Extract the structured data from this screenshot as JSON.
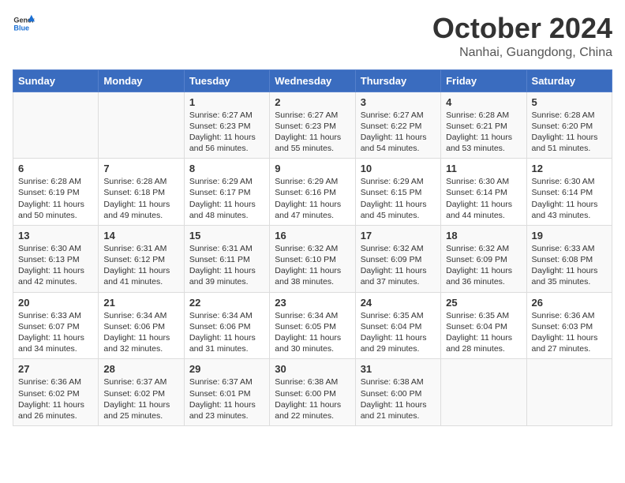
{
  "header": {
    "logo_general": "General",
    "logo_blue": "Blue",
    "title": "October 2024",
    "location": "Nanhai, Guangdong, China"
  },
  "calendar": {
    "weekdays": [
      "Sunday",
      "Monday",
      "Tuesday",
      "Wednesday",
      "Thursday",
      "Friday",
      "Saturday"
    ],
    "weeks": [
      [
        {
          "day": "",
          "text": ""
        },
        {
          "day": "",
          "text": ""
        },
        {
          "day": "1",
          "text": "Sunrise: 6:27 AM\nSunset: 6:23 PM\nDaylight: 11 hours and 56 minutes."
        },
        {
          "day": "2",
          "text": "Sunrise: 6:27 AM\nSunset: 6:23 PM\nDaylight: 11 hours and 55 minutes."
        },
        {
          "day": "3",
          "text": "Sunrise: 6:27 AM\nSunset: 6:22 PM\nDaylight: 11 hours and 54 minutes."
        },
        {
          "day": "4",
          "text": "Sunrise: 6:28 AM\nSunset: 6:21 PM\nDaylight: 11 hours and 53 minutes."
        },
        {
          "day": "5",
          "text": "Sunrise: 6:28 AM\nSunset: 6:20 PM\nDaylight: 11 hours and 51 minutes."
        }
      ],
      [
        {
          "day": "6",
          "text": "Sunrise: 6:28 AM\nSunset: 6:19 PM\nDaylight: 11 hours and 50 minutes."
        },
        {
          "day": "7",
          "text": "Sunrise: 6:28 AM\nSunset: 6:18 PM\nDaylight: 11 hours and 49 minutes."
        },
        {
          "day": "8",
          "text": "Sunrise: 6:29 AM\nSunset: 6:17 PM\nDaylight: 11 hours and 48 minutes."
        },
        {
          "day": "9",
          "text": "Sunrise: 6:29 AM\nSunset: 6:16 PM\nDaylight: 11 hours and 47 minutes."
        },
        {
          "day": "10",
          "text": "Sunrise: 6:29 AM\nSunset: 6:15 PM\nDaylight: 11 hours and 45 minutes."
        },
        {
          "day": "11",
          "text": "Sunrise: 6:30 AM\nSunset: 6:14 PM\nDaylight: 11 hours and 44 minutes."
        },
        {
          "day": "12",
          "text": "Sunrise: 6:30 AM\nSunset: 6:14 PM\nDaylight: 11 hours and 43 minutes."
        }
      ],
      [
        {
          "day": "13",
          "text": "Sunrise: 6:30 AM\nSunset: 6:13 PM\nDaylight: 11 hours and 42 minutes."
        },
        {
          "day": "14",
          "text": "Sunrise: 6:31 AM\nSunset: 6:12 PM\nDaylight: 11 hours and 41 minutes."
        },
        {
          "day": "15",
          "text": "Sunrise: 6:31 AM\nSunset: 6:11 PM\nDaylight: 11 hours and 39 minutes."
        },
        {
          "day": "16",
          "text": "Sunrise: 6:32 AM\nSunset: 6:10 PM\nDaylight: 11 hours and 38 minutes."
        },
        {
          "day": "17",
          "text": "Sunrise: 6:32 AM\nSunset: 6:09 PM\nDaylight: 11 hours and 37 minutes."
        },
        {
          "day": "18",
          "text": "Sunrise: 6:32 AM\nSunset: 6:09 PM\nDaylight: 11 hours and 36 minutes."
        },
        {
          "day": "19",
          "text": "Sunrise: 6:33 AM\nSunset: 6:08 PM\nDaylight: 11 hours and 35 minutes."
        }
      ],
      [
        {
          "day": "20",
          "text": "Sunrise: 6:33 AM\nSunset: 6:07 PM\nDaylight: 11 hours and 34 minutes."
        },
        {
          "day": "21",
          "text": "Sunrise: 6:34 AM\nSunset: 6:06 PM\nDaylight: 11 hours and 32 minutes."
        },
        {
          "day": "22",
          "text": "Sunrise: 6:34 AM\nSunset: 6:06 PM\nDaylight: 11 hours and 31 minutes."
        },
        {
          "day": "23",
          "text": "Sunrise: 6:34 AM\nSunset: 6:05 PM\nDaylight: 11 hours and 30 minutes."
        },
        {
          "day": "24",
          "text": "Sunrise: 6:35 AM\nSunset: 6:04 PM\nDaylight: 11 hours and 29 minutes."
        },
        {
          "day": "25",
          "text": "Sunrise: 6:35 AM\nSunset: 6:04 PM\nDaylight: 11 hours and 28 minutes."
        },
        {
          "day": "26",
          "text": "Sunrise: 6:36 AM\nSunset: 6:03 PM\nDaylight: 11 hours and 27 minutes."
        }
      ],
      [
        {
          "day": "27",
          "text": "Sunrise: 6:36 AM\nSunset: 6:02 PM\nDaylight: 11 hours and 26 minutes."
        },
        {
          "day": "28",
          "text": "Sunrise: 6:37 AM\nSunset: 6:02 PM\nDaylight: 11 hours and 25 minutes."
        },
        {
          "day": "29",
          "text": "Sunrise: 6:37 AM\nSunset: 6:01 PM\nDaylight: 11 hours and 23 minutes."
        },
        {
          "day": "30",
          "text": "Sunrise: 6:38 AM\nSunset: 6:00 PM\nDaylight: 11 hours and 22 minutes."
        },
        {
          "day": "31",
          "text": "Sunrise: 6:38 AM\nSunset: 6:00 PM\nDaylight: 11 hours and 21 minutes."
        },
        {
          "day": "",
          "text": ""
        },
        {
          "day": "",
          "text": ""
        }
      ]
    ]
  }
}
